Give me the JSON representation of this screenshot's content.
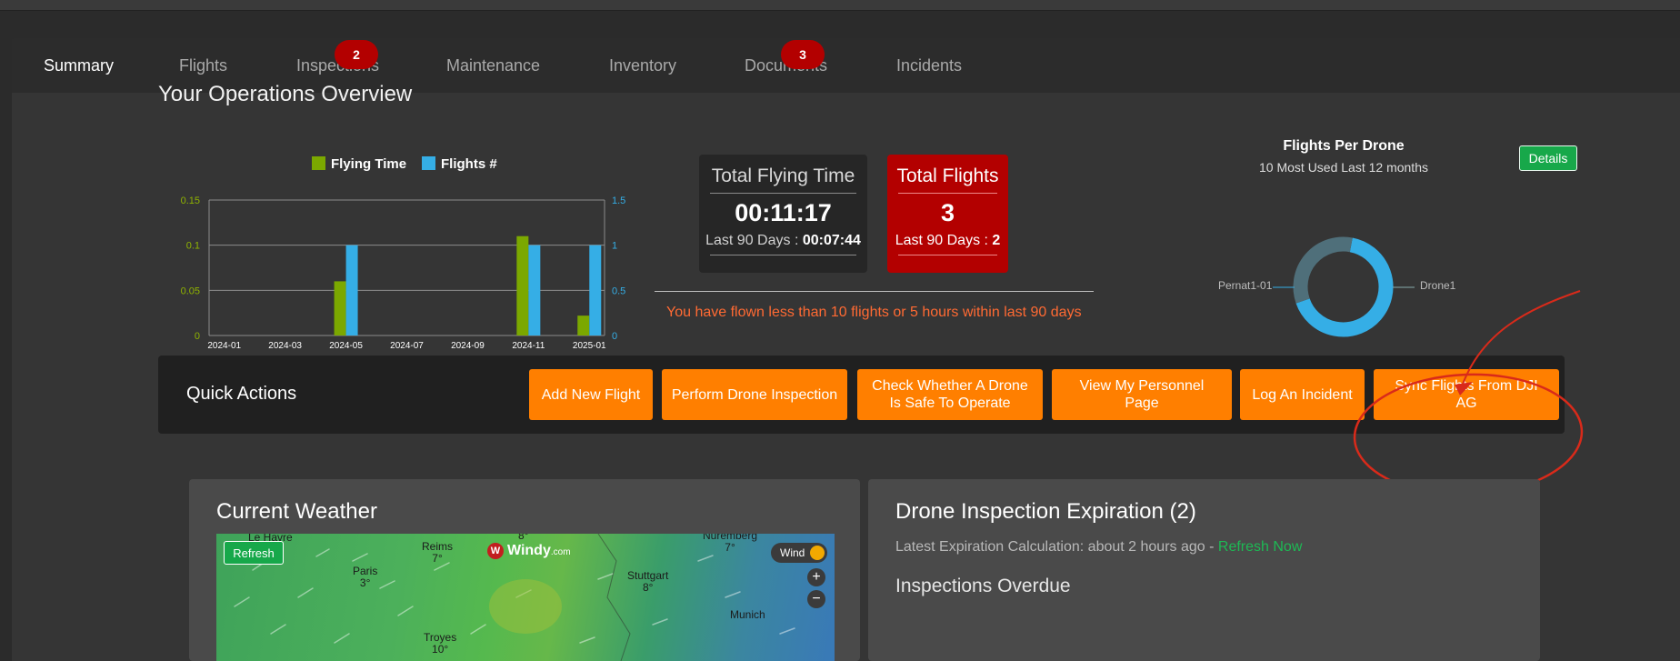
{
  "tabs": [
    {
      "label": "Summary",
      "badge": null
    },
    {
      "label": "Flights",
      "badge": null
    },
    {
      "label": "Inspections",
      "badge": "2"
    },
    {
      "label": "Maintenance",
      "badge": null
    },
    {
      "label": "Inventory",
      "badge": null
    },
    {
      "label": "Documents",
      "badge": "3"
    },
    {
      "label": "Incidents",
      "badge": null
    }
  ],
  "overview": {
    "title": "Your Operations Overview"
  },
  "chart_data": {
    "type": "bar",
    "categories": [
      "2024-01",
      "2024-02",
      "2024-03",
      "2024-04",
      "2024-05",
      "2024-06",
      "2024-07",
      "2024-08",
      "2024-09",
      "2024-10",
      "2024-11",
      "2024-12",
      "2025-01"
    ],
    "tick_labels": [
      "2024-01",
      "2024-03",
      "2024-05",
      "2024-07",
      "2024-09",
      "2024-11",
      "2025-01"
    ],
    "series": [
      {
        "name": "Flying Time",
        "axis": "left",
        "color": "#7ba800",
        "values": [
          0,
          0,
          0,
          0,
          0.06,
          0,
          0,
          0,
          0,
          0,
          0.11,
          0,
          0.022
        ]
      },
      {
        "name": "Flights #",
        "axis": "right",
        "color": "#35aee6",
        "values": [
          0,
          0,
          0,
          0,
          1,
          0,
          0,
          0,
          0,
          0,
          1,
          0,
          1
        ]
      }
    ],
    "ylim_left": [
      0,
      0.15
    ],
    "yticks_left": [
      "0",
      "0.05",
      "0.1",
      "0.15"
    ],
    "ylim_right": [
      0,
      1.5
    ],
    "yticks_right": [
      "0",
      "0.5",
      "1",
      "1.5"
    ],
    "legend_placement": "top-center",
    "grid": true
  },
  "stats": {
    "flying_time": {
      "label": "Total Flying Time",
      "value": "00:11:17",
      "sub_prefix": "Last 90 Days : ",
      "sub_value": "00:07:44"
    },
    "flights": {
      "label": "Total Flights",
      "value": "3",
      "sub_prefix": "Last 90 Days : ",
      "sub_value": "2"
    },
    "warning": "You have flown less than 10 flights or 5 hours within last 90 days"
  },
  "donut": {
    "title": "Flights Per Drone",
    "subtitle": "10 Most Used Last 12 months",
    "details_label": "Details",
    "chart_data": {
      "type": "pie",
      "labels": [
        "Pernat1-01",
        "Drone1"
      ],
      "values": [
        2,
        1
      ],
      "colors": [
        "#35aee6",
        "#4f6f7a"
      ]
    }
  },
  "quick_actions": {
    "title": "Quick Actions",
    "buttons": [
      "Add New Flight",
      "Perform Drone Inspection",
      "Check Whether A Drone Is Safe To Operate",
      "View My Personnel Page",
      "Log An Incident",
      "Sync Flights From DJI AG"
    ],
    "annotation_color": "#d92a1a"
  },
  "weather": {
    "title": "Current Weather",
    "refresh_label": "Refresh",
    "brand": "Windy",
    "brand_suffix": ".com",
    "wind_label": "Wind",
    "zoom_in": "+",
    "zoom_out": "−",
    "places": [
      {
        "name": "Le Havre",
        "temp": ""
      },
      {
        "name": "Reims",
        "temp": "7°"
      },
      {
        "name": "Paris",
        "temp": "3°"
      },
      {
        "name": "Troyes",
        "temp": "10°"
      },
      {
        "name": "Stuttgart",
        "temp": "8°"
      },
      {
        "name": "Nuremberg",
        "temp": "7°"
      },
      {
        "name": "Munich",
        "temp": ""
      },
      {
        "name": "",
        "temp": "8°"
      }
    ]
  },
  "inspection": {
    "title": "Drone Inspection Expiration (2)",
    "calc_text": "Latest Expiration Calculation: about 2 hours ago - ",
    "refresh_link": "Refresh Now",
    "overdue_title": "Inspections Overdue"
  }
}
